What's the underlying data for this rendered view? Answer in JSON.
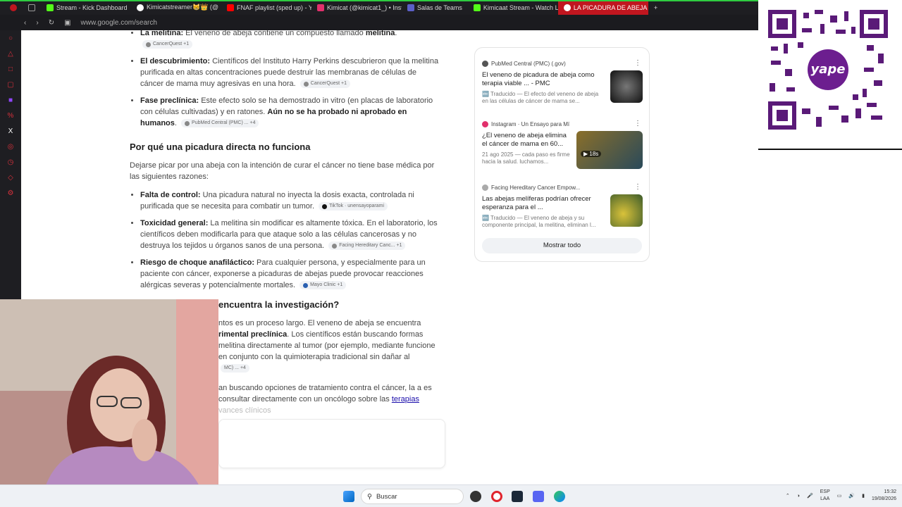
{
  "browser": {
    "tabs": [
      {
        "label": "",
        "color": "#c0161f"
      },
      {
        "label": "",
        "color": "#999999"
      },
      {
        "label": "Stream - Kick Dashboard",
        "color": "#53fc18"
      },
      {
        "label": "Kimicatstreamer😸👑 (@",
        "color": "#ffffff"
      },
      {
        "label": "FNAF playlist (sped up) - Y",
        "color": "#ff0000"
      },
      {
        "label": "Kimicat (@kimicat1_) • Insta",
        "color": "#e1306c"
      },
      {
        "label": "Salas de Teams",
        "color": "#5b5fc7"
      },
      {
        "label": "Kimicaat Stream - Watch L",
        "color": "#53fc18"
      },
      {
        "label": "LA PICADURA DE ABEJA TI",
        "color": "#ffffff",
        "active": true
      }
    ],
    "new_tab": "+",
    "url": "www.google.com/search",
    "accent": "#2ecc40"
  },
  "article": {
    "top_item": {
      "bold": "La melitina:",
      "text": " El veneno de abeja contiene un compuesto llamado ",
      "bold2": "melitina",
      "chip": "CancerQuest +1"
    },
    "list1": [
      {
        "bold": "El descubrimiento:",
        "text": " Científicos del Instituto Harry Perkins descubrieron que la melitina purificada en altas concentraciones puede destruir las membranas de células de cáncer de mama muy agresivas en una hora.",
        "chip": "CancerQuest +1"
      },
      {
        "bold": "Fase preclínica:",
        "text": " Este efecto solo se ha demostrado in vitro (en placas de laboratorio con células cultivadas) y en ratones. ",
        "bold2": "Aún no se ha probado ni aprobado en humanos",
        "chip": "PubMed Central (PMC) ... +4"
      }
    ],
    "heading2": "Por qué una picadura directa no funciona",
    "intro2": "Dejarse picar por una abeja con la intención de curar el cáncer no tiene base médica por las siguientes razones:",
    "list2": [
      {
        "bold": "Falta de control:",
        "text": " Una picadura natural no inyecta la dosis exacta, controlada ni purificada que se necesita para combatir un tumor.",
        "chip": "TikTok · unensayoparami"
      },
      {
        "bold": "Toxicidad general:",
        "text": " La melitina sin modificar es altamente tóxica. En el laboratorio, los científicos deben modificarla para que ataque solo a las células cancerosas y no destruya los tejidos u órganos sanos de una persona.",
        "chip": "Facing Hereditary Canc... +1"
      },
      {
        "bold": "Riesgo de choque anafiláctico:",
        "text": " Para cualquier persona, y especialmente para un paciente con cáncer, exponerse a picaduras de abejas puede provocar reacciones alérgicas severas y potencialmente mortales.",
        "chip": "Mayo Clinic +1"
      }
    ],
    "heading3": "encuentra la investigación?",
    "para3a": "ntos es un proceso largo. El veneno de abeja se encuentra",
    "para3b_bold": "rimental preclínica",
    "para3b": ". Los científicos están buscando formas",
    "para3c": "melitina directamente al tumor (por ejemplo, mediante",
    "para3d": "funcione en conjunto con la quimioterapia tradicional sin dañar al",
    "para3chip": "MC) ... +4",
    "para4a": "an buscando opciones de tratamiento contra el cáncer, la",
    "para4b": "a es consultar directamente con un oncólogo sobre las ",
    "para4link": "terapias",
    "para4c": "vances clínicos"
  },
  "sources": {
    "cards": [
      {
        "source": "PubMed Central (PMC) (.gov)",
        "title": "El veneno de picadura de abeja como terapia viable ... - PMC",
        "snippet": "Traducido — El efecto del veneno de abeja en las células de cáncer de mama se...",
        "thumb_color": "#222222"
      },
      {
        "source": "Instagram · Un Ensayo para Mí",
        "title": "¿El veneno de abeja elimina el cáncer de mama en 60...",
        "snippet": "21 ago 2025 — cada paso es firme hacia la salud. luchamos...",
        "thumb_color": "#6a5a2a",
        "video": "18s"
      },
      {
        "source": "Facing Hereditary Cancer Empow...",
        "title": "Las abejas melíferas podrían ofrecer esperanza para el ...",
        "snippet": "Traducido — El veneno de abeja y su componente principal, la melitina, eliminan l...",
        "thumb_color": "#4a6a2a"
      }
    ],
    "show_all": "Mostrar todo"
  },
  "qr": {
    "brand": "yape",
    "symbol": "S/",
    "brand_color": "#6c1e8f"
  },
  "taskbar": {
    "search_placeholder": "Buscar",
    "lang1": "ESP",
    "lang2": "LAA",
    "time": "15:32",
    "date": "19/08/2026"
  }
}
